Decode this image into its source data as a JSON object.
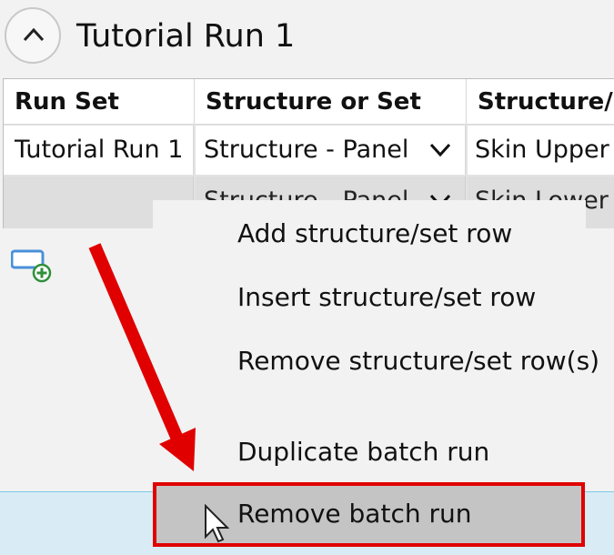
{
  "header": {
    "title": "Tutorial Run 1",
    "collapse_icon": "chevron-up-icon"
  },
  "grid": {
    "columns": [
      "Run Set",
      "Structure or Set",
      "Structure/S"
    ],
    "rows": [
      [
        "Tutorial Run 1",
        "Structure - Panel",
        "Skin Upper"
      ],
      [
        "",
        "Structure - Panel",
        "Skin Lower"
      ]
    ]
  },
  "add_row_icon": "add-row-icon",
  "context_menu": {
    "items": [
      "Add structure/set row",
      "Insert structure/set row",
      "Remove structure/set row(s)",
      "Duplicate batch run",
      "Remove batch run"
    ],
    "highlighted_index": 4
  },
  "annotation": {
    "arrow_color": "#e00000",
    "box_color": "#e00000"
  }
}
